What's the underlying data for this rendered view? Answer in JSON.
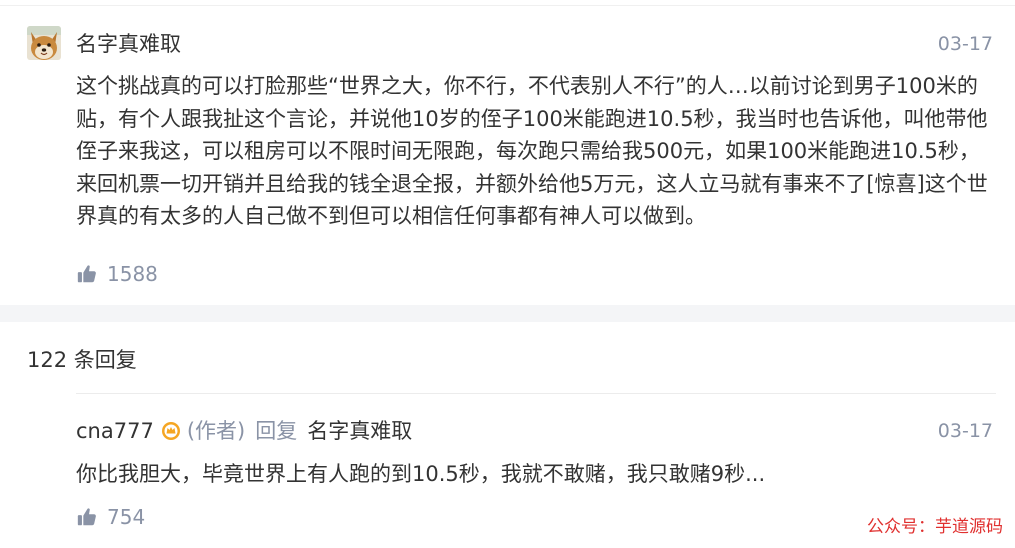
{
  "comment": {
    "username": "名字真难取",
    "date": "03-17",
    "text": "这个挑战真的可以打脸那些“世界之大，你不行，不代表别人不行”的人…以前讨论到男子100米的贴，有个人跟我扯这个言论，并说他10岁的侄子100米能跑进10.5秒，我当时也告诉他，叫他带他侄子来我这，可以租房可以不限时间无限跑，每次跑只需给我500元，如果100米能跑进10.5秒，来回机票一切开销并且给我的钱全退全报，并额外给他5万元，这人立马就有事来不了[惊喜]这个世界真的有太多的人自己做不到但可以相信任何事都有神人可以做到。",
    "likes": "1588"
  },
  "replies_header": "122 条回复",
  "reply": {
    "username": "cna777",
    "author_tag": "(作者)",
    "reply_word": "回复",
    "reply_to": "名字真难取",
    "date": "03-17",
    "text": "你比我胆大，毕竟世界上有人跑的到10.5秒，我就不敢赌，我只敢赌9秒...",
    "likes": "754"
  },
  "watermark": "公众号：芋道源码",
  "colors": {
    "text": "#333333",
    "muted": "#8a93a6",
    "divider": "#f4f5f7",
    "badge": "#f5a623",
    "watermark": "#e0302f"
  },
  "icons": {
    "like": "thumbs-up-icon",
    "author_badge": "author-badge-icon",
    "avatar": "shiba-dog-avatar"
  }
}
